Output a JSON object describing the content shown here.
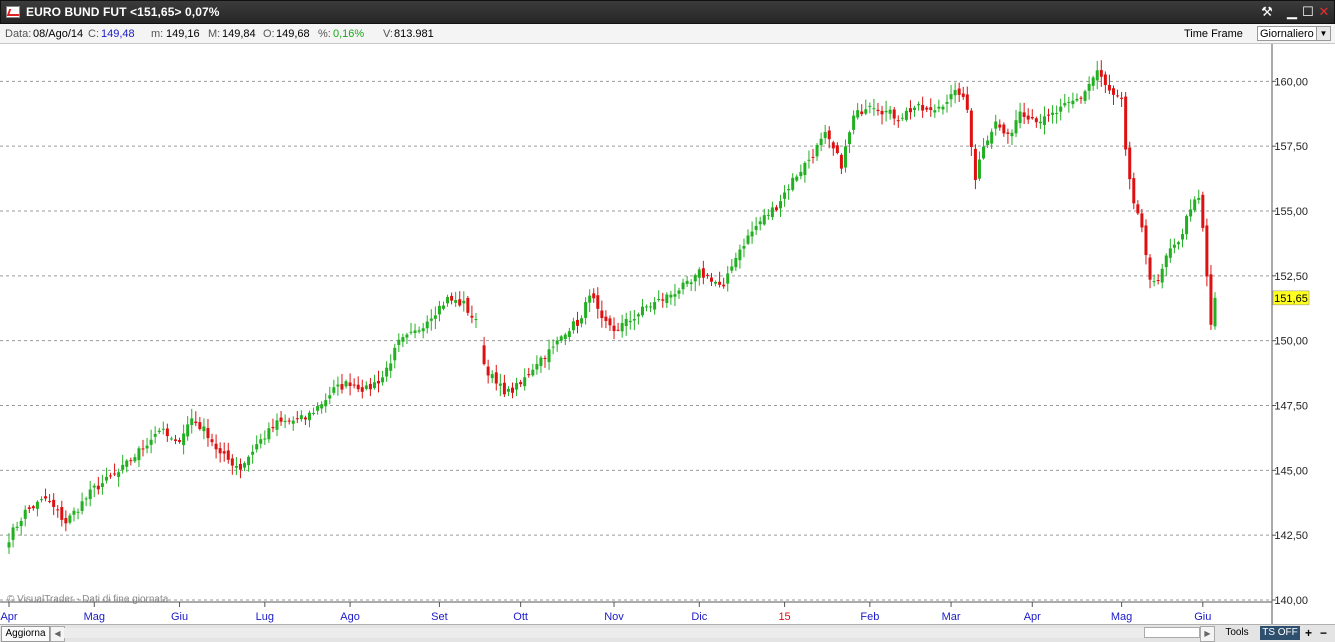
{
  "window": {
    "title": "EURO BUND FUT <151,65> 0,07%",
    "controls": {
      "tools": "⚒",
      "minimize": "▁",
      "maximize": "☐",
      "close": "✕"
    },
    "close_color": "#e03030"
  },
  "info": {
    "data_label": "Data:",
    "data_value": "08/Ago/14",
    "c_label": "C:",
    "c_value": "149,48",
    "m_label": "m:",
    "m_value": "149,16",
    "mx_label": "M:",
    "mx_value": "149,84",
    "o_label": "O:",
    "o_value": "149,68",
    "pct_label": "%:",
    "pct_value": "0,16%",
    "v_label": "V:",
    "v_value": "813.981",
    "time_frame_label": "Time Frame",
    "time_frame_value": "Giornaliero"
  },
  "colors": {
    "up": "#22b022",
    "down": "#dd1111",
    "grid": "#9a9a9a",
    "month_label": "#1a1ac8",
    "year_label": "#dd1111",
    "price_badge": "#ffff20"
  },
  "watermark": "© VisualTrader - Dati di fine giornata",
  "chart_data": {
    "type": "candlestick",
    "title": "EURO BUND FUT",
    "ylim": [
      140,
      160.9
    ],
    "y_ticks": [
      "160,00",
      "157,50",
      "155,00",
      "152,50",
      "150,00",
      "147,50",
      "145,00",
      "142,50",
      "140,00"
    ],
    "y_tick_values": [
      160,
      157.5,
      155,
      152.5,
      150,
      147.5,
      145,
      142.5,
      140
    ],
    "last_price_label": "151,65",
    "last_price": 151.65,
    "months": [
      "Apr",
      "Mag",
      "Giu",
      "Lug",
      "Ago",
      "Set",
      "Ott",
      "Nov",
      "Dic",
      "15",
      "Feb",
      "Mar",
      "Apr",
      "Mag",
      "Giu"
    ],
    "month_colors": [
      "month",
      "month",
      "month",
      "month",
      "month",
      "month",
      "month",
      "month",
      "month",
      "year",
      "month",
      "month",
      "month",
      "month",
      "month"
    ],
    "month_start_index": [
      0,
      21,
      42,
      63,
      84,
      106,
      126,
      149,
      170,
      191,
      212,
      232,
      252,
      274,
      294
    ],
    "total_bars": 298,
    "close_anchors": [
      [
        0,
        142.4
      ],
      [
        4,
        143.4
      ],
      [
        9,
        143.9
      ],
      [
        14,
        143.0
      ],
      [
        21,
        144.3
      ],
      [
        27,
        144.9
      ],
      [
        33,
        145.9
      ],
      [
        37,
        146.6
      ],
      [
        41,
        146.0
      ],
      [
        45,
        147.0
      ],
      [
        49,
        146.4
      ],
      [
        52,
        145.6
      ],
      [
        57,
        145.1
      ],
      [
        61,
        146.0
      ],
      [
        66,
        146.8
      ],
      [
        73,
        147.0
      ],
      [
        77,
        147.6
      ],
      [
        80,
        148.1
      ],
      [
        84,
        148.4
      ],
      [
        88,
        148.1
      ],
      [
        92,
        148.6
      ],
      [
        96,
        149.9
      ],
      [
        100,
        150.3
      ],
      [
        104,
        151.0
      ],
      [
        108,
        151.6
      ],
      [
        112,
        151.4
      ],
      [
        115,
        150.7
      ],
      [
        117,
        149.1
      ],
      [
        120,
        148.3
      ],
      [
        123,
        148.0
      ],
      [
        126,
        148.3
      ],
      [
        130,
        149.2
      ],
      [
        134,
        149.7
      ],
      [
        137,
        150.4
      ],
      [
        141,
        150.8
      ],
      [
        143,
        151.9
      ],
      [
        146,
        150.7
      ],
      [
        149,
        150.4
      ],
      [
        153,
        150.8
      ],
      [
        157,
        151.3
      ],
      [
        161,
        151.6
      ],
      [
        165,
        152.0
      ],
      [
        168,
        152.2
      ],
      [
        170,
        152.6
      ],
      [
        173,
        152.4
      ],
      [
        176,
        152.0
      ],
      [
        179,
        153.3
      ],
      [
        182,
        154.0
      ],
      [
        185,
        154.6
      ],
      [
        189,
        155.2
      ],
      [
        193,
        156.2
      ],
      [
        197,
        157.0
      ],
      [
        201,
        157.9
      ],
      [
        205,
        156.8
      ],
      [
        208,
        158.6
      ],
      [
        212,
        159.2
      ],
      [
        215,
        158.9
      ],
      [
        219,
        158.6
      ],
      [
        223,
        159.0
      ],
      [
        227,
        158.8
      ],
      [
        231,
        159.3
      ],
      [
        234,
        159.6
      ],
      [
        236,
        158.9
      ],
      [
        238,
        156.3
      ],
      [
        240,
        157.6
      ],
      [
        243,
        158.4
      ],
      [
        246,
        157.8
      ],
      [
        249,
        158.9
      ],
      [
        252,
        158.6
      ],
      [
        255,
        158.5
      ],
      [
        258,
        158.8
      ],
      [
        261,
        159.1
      ],
      [
        264,
        159.4
      ],
      [
        266,
        159.9
      ],
      [
        268,
        160.4
      ],
      [
        270,
        159.8
      ],
      [
        272,
        159.4
      ],
      [
        274,
        159.2
      ],
      [
        275,
        157.2
      ],
      [
        277,
        155.3
      ],
      [
        279,
        154.2
      ],
      [
        281,
        152.5
      ],
      [
        283,
        152.2
      ],
      [
        285,
        153.2
      ],
      [
        287,
        153.6
      ],
      [
        289,
        154.2
      ],
      [
        291,
        155.2
      ],
      [
        293,
        155.4
      ],
      [
        294,
        154.3
      ],
      [
        295,
        152.4
      ],
      [
        296,
        150.6
      ],
      [
        297,
        151.65
      ]
    ]
  },
  "bottom": {
    "aggiorna": "Aggiorna",
    "scroll_left": "◀",
    "scroll_right": "▶",
    "tools": "Tools",
    "ts_off": "TS OFF",
    "plus": "+",
    "minus": "−"
  }
}
